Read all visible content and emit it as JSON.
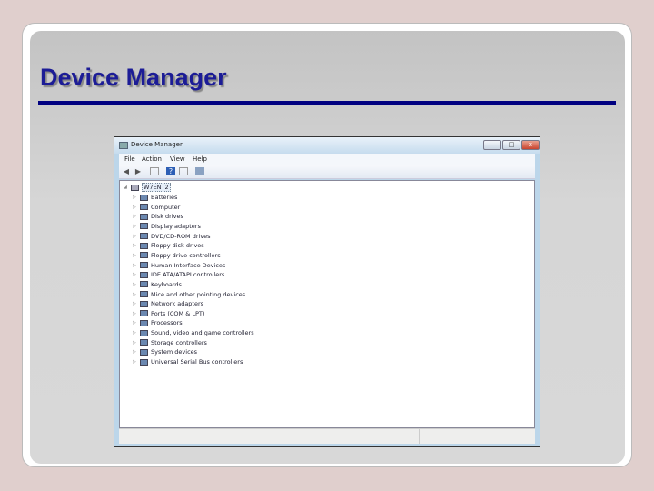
{
  "slide": {
    "title": "Device Manager"
  },
  "window": {
    "title": "Device Manager",
    "minimize": "–",
    "maximize": "□",
    "close": "x",
    "menu": [
      "File",
      "Action",
      "View",
      "Help"
    ],
    "root": "W7ENT2",
    "devices": [
      "Batteries",
      "Computer",
      "Disk drives",
      "Display adapters",
      "DVD/CD-ROM drives",
      "Floppy disk drives",
      "Floppy drive controllers",
      "Human Interface Devices",
      "IDE ATA/ATAPI controllers",
      "Keyboards",
      "Mice and other pointing devices",
      "Network adapters",
      "Ports (COM & LPT)",
      "Processors",
      "Sound, video and game controllers",
      "Storage controllers",
      "System devices",
      "Universal Serial Bus controllers"
    ]
  },
  "colors": {
    "title": "#1c1c96",
    "rule": "#000080",
    "close": "#d9534f"
  }
}
